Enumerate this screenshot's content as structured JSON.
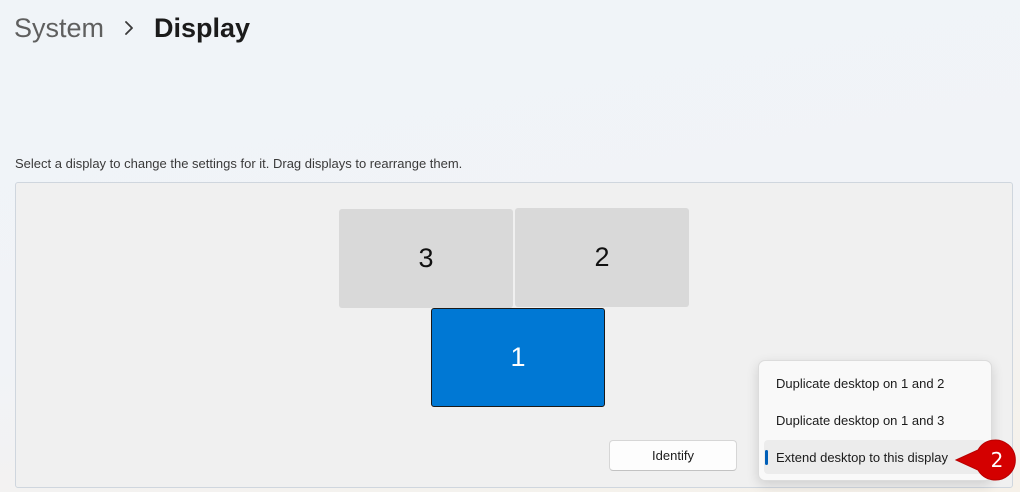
{
  "breadcrumb": {
    "parent": "System",
    "current": "Display"
  },
  "instructions": "Select a display to change the settings for it. Drag displays to rearrange them.",
  "monitors": [
    {
      "label": "3",
      "selected": false
    },
    {
      "label": "2",
      "selected": false
    },
    {
      "label": "1",
      "selected": true
    }
  ],
  "identify_label": "Identify",
  "menu": {
    "items": [
      {
        "label": "Duplicate desktop on 1 and 2"
      },
      {
        "label": "Duplicate desktop on 1 and 3"
      },
      {
        "label": "Extend desktop to this display",
        "selected": true
      }
    ]
  },
  "step_badge": "2",
  "colors": {
    "accent": "#0078d4",
    "badge": "#d40000",
    "indicator": "#005fb8"
  }
}
